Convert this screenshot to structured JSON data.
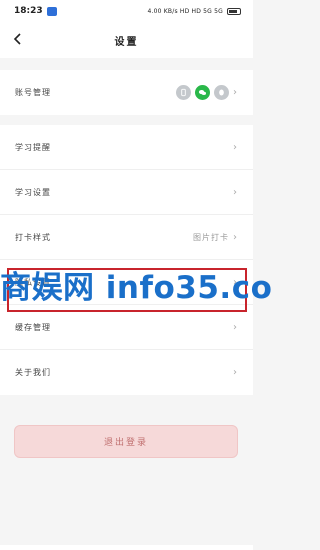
{
  "status": {
    "time": "18:23",
    "right": "4.00 KB/s  HD  HD  5G  5G"
  },
  "header": {
    "title": "设置"
  },
  "rows1": [
    {
      "label": "账号管理",
      "icons": [
        "phone-icon",
        "wechat-icon",
        "qq-icon"
      ]
    }
  ],
  "rows2": [
    {
      "label": "学习提醒",
      "value": ""
    },
    {
      "label": "学习设置",
      "value": ""
    },
    {
      "label": "打卡样式",
      "value": "图片打卡"
    },
    {
      "label": "隐私设置",
      "value": ""
    },
    {
      "label": "缓存管理",
      "value": ""
    },
    {
      "label": "关于我们",
      "value": ""
    }
  ],
  "logout_label": "退出登录",
  "watermark": "商娱网 info35.co"
}
